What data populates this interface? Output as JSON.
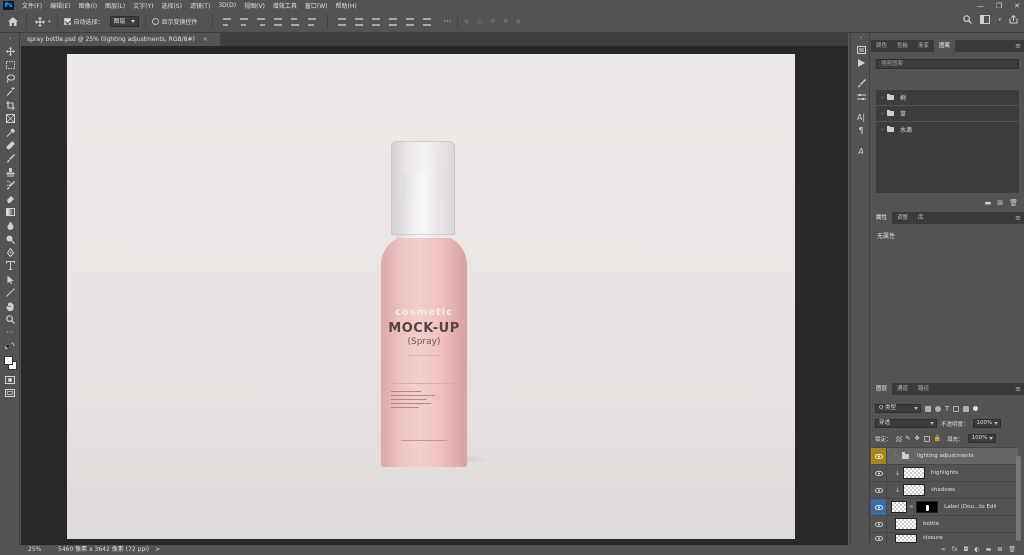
{
  "app": {
    "logo": "Ps"
  },
  "menu": [
    "文件(F)",
    "编辑(E)",
    "图像(I)",
    "图层(L)",
    "文字(Y)",
    "选择(S)",
    "滤镜(T)",
    "3D(D)",
    "视图(V)",
    "增效工具",
    "窗口(W)",
    "帮助(H)"
  ],
  "window_controls": {
    "minimize": "—",
    "restore": "❐",
    "close": "✕"
  },
  "options_bar": {
    "auto_select_label": "自动选择：",
    "auto_select_value": "图层",
    "show_transform_label": "显示变换控件",
    "more": "···"
  },
  "document": {
    "tab_title": "spray bottle.psd @ 25% (lighting adjustments, RGB/8#)",
    "tab_close": "×",
    "zoom": "25%",
    "size_info": "5460 像素 x 3642 像素 (72 ppi)",
    "status_arrow": ">"
  },
  "bottle": {
    "brand": "cosmetic",
    "title": "MOCK-UP",
    "subtitle": "(Spray)"
  },
  "panels": {
    "top_tabs": [
      "颜色",
      "色板",
      "渐变",
      "图案"
    ],
    "library_search_placeholder": "搜索图案",
    "library_groups": [
      "树",
      "草",
      "水滴"
    ],
    "props_tabs": [
      "属性",
      "调整",
      "库"
    ],
    "props_text": "无属性",
    "layers_tabs": [
      "图层",
      "通道",
      "路径"
    ],
    "kind_filter": "Q 类型",
    "blend_mode": "穿透",
    "opacity_label": "不透明度：",
    "opacity_value": "100%",
    "lock_label": "锁定：",
    "fill_label": "填充：",
    "fill_value": "100%",
    "layers": [
      {
        "name": "lighting adjustments",
        "type": "group"
      },
      {
        "name": "highlights",
        "type": "clip"
      },
      {
        "name": "shadows",
        "type": "clip"
      },
      {
        "name": "Label (Dou...to Edit)",
        "type": "smart"
      },
      {
        "name": "bottle",
        "type": "pixel"
      },
      {
        "name": "closure",
        "type": "pixel"
      }
    ]
  }
}
